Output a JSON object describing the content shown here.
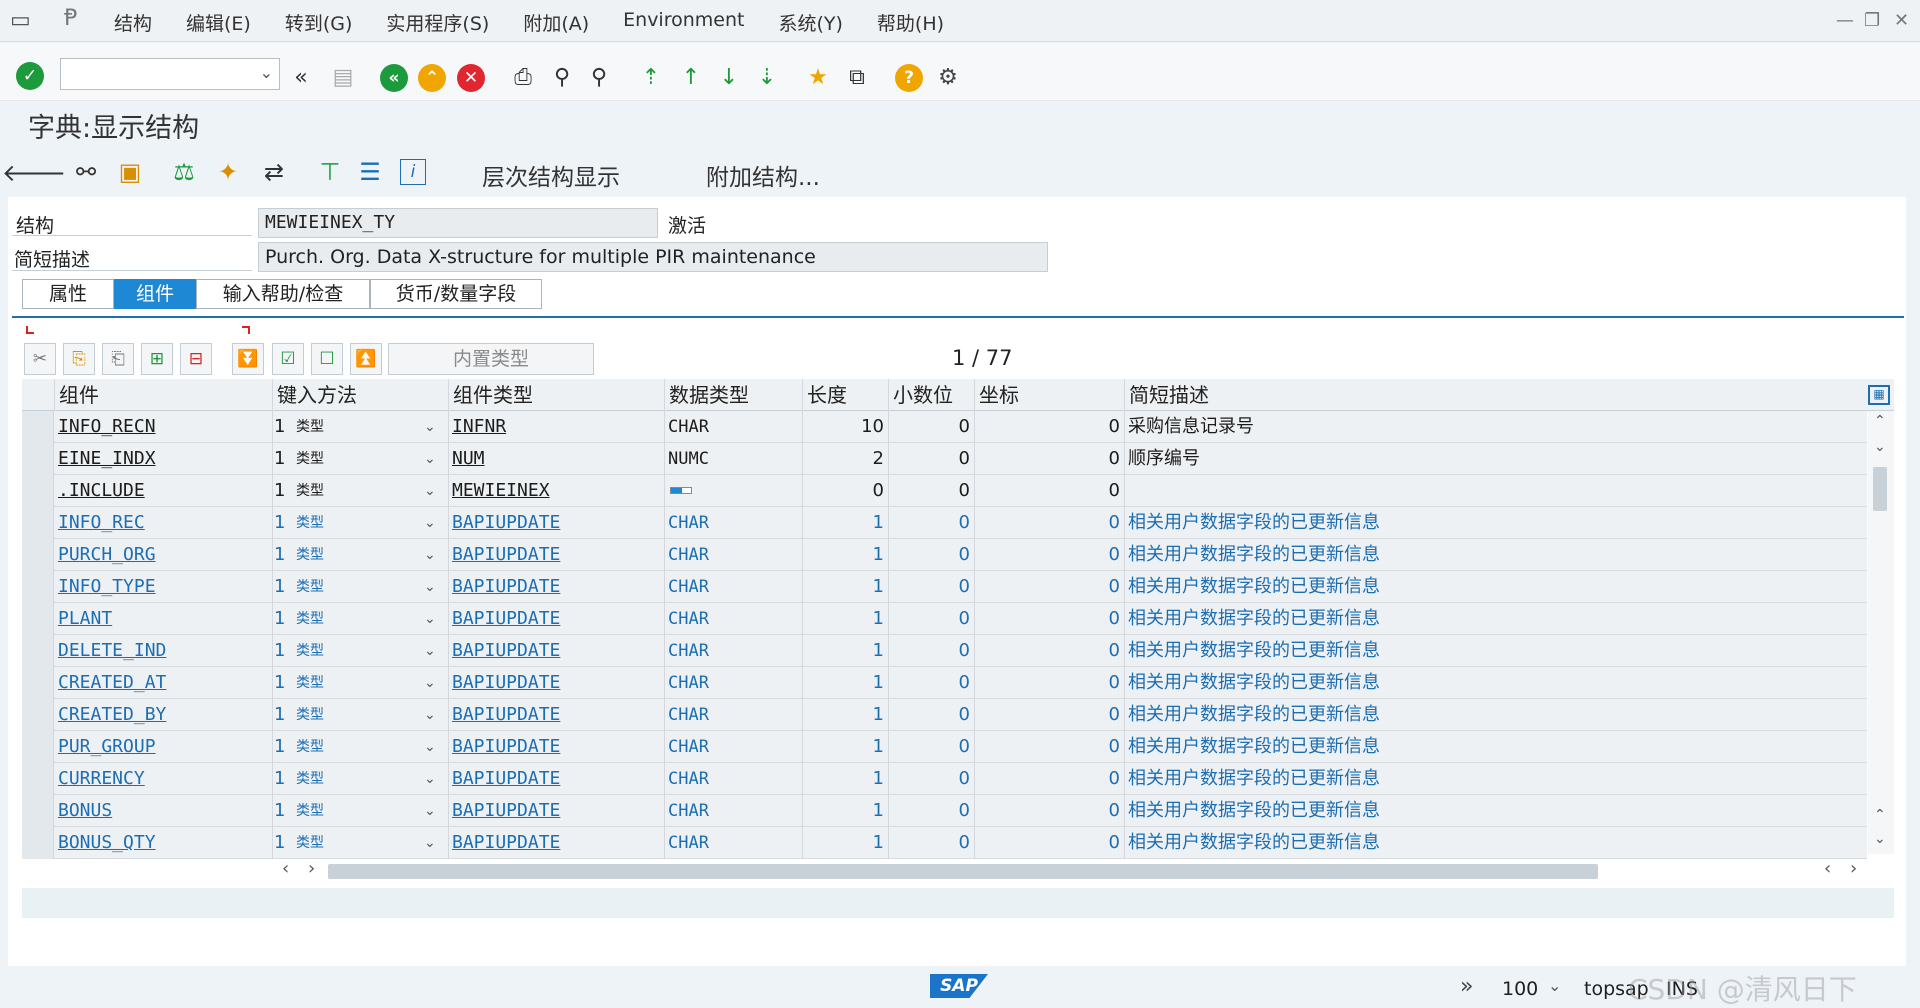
{
  "menu": {
    "items": [
      "结构",
      "编辑(E)",
      "转到(G)",
      "实用程序(S)",
      "附加(A)",
      "Environment",
      "系统(Y)",
      "帮助(H)"
    ]
  },
  "window": {
    "min": "—",
    "restore": "❐",
    "close": "✕"
  },
  "toolbar": {
    "icons": [
      "enter-icon",
      "back-nav-icon",
      "save-icon",
      "back-icon",
      "exit-icon",
      "cancel-icon",
      "print-icon",
      "find-icon",
      "find-next-icon",
      "first-page-icon",
      "prev-page-icon",
      "next-page-icon",
      "last-page-icon",
      "new-session-icon",
      "shortcut-icon",
      "help-icon",
      "settings-icon"
    ]
  },
  "page": {
    "title": "字典:显示结构"
  },
  "app_toolbar": {
    "hierarchy_label": "层次结构显示",
    "append_label": "附加结构..."
  },
  "header": {
    "struct_label": "结构",
    "struct_value": "MEWIEINEX_TY",
    "status": "激活",
    "desc_label": "简短描述",
    "desc_value": "Purch. Org. Data X-structure for multiple PIR maintenance"
  },
  "tabs": [
    {
      "label": "属性"
    },
    {
      "label": "组件"
    },
    {
      "label": "输入帮助/检查"
    },
    {
      "label": "货币/数量字段"
    }
  ],
  "table_toolbar": {
    "builtin_label": "内置类型",
    "pager": "1 / 77"
  },
  "table": {
    "columns": [
      "组件",
      "键入方法",
      "组件类型",
      "数据类型",
      "长度",
      "小数位",
      "坐标",
      "简短描述"
    ],
    "rows": [
      {
        "component": "INFO_RECN",
        "typing": "1",
        "typing_text": "类型",
        "comp_type": "INFNR",
        "data_type": "CHAR",
        "length": "10",
        "decimals": "0",
        "coord": "0",
        "desc": "采购信息记录号",
        "style": "dark"
      },
      {
        "component": "EINE_INDX",
        "typing": "1",
        "typing_text": "类型",
        "comp_type": "NUM",
        "data_type": "NUMC",
        "length": "2",
        "decimals": "0",
        "coord": "0",
        "desc": "顺序编号",
        "style": "dark"
      },
      {
        "component": ".INCLUDE",
        "typing": "1",
        "typing_text": "类型",
        "comp_type": "MEWIEINEX",
        "data_type": "",
        "length": "0",
        "decimals": "0",
        "coord": "0",
        "desc": "",
        "style": "dark"
      },
      {
        "component": "INFO_REC",
        "typing": "1",
        "typing_text": "类型",
        "comp_type": "BAPIUPDATE",
        "data_type": "CHAR",
        "length": "1",
        "decimals": "0",
        "coord": "0",
        "desc": "相关用户数据字段的已更新信息",
        "style": "blue"
      },
      {
        "component": "PURCH_ORG",
        "typing": "1",
        "typing_text": "类型",
        "comp_type": "BAPIUPDATE",
        "data_type": "CHAR",
        "length": "1",
        "decimals": "0",
        "coord": "0",
        "desc": "相关用户数据字段的已更新信息",
        "style": "blue"
      },
      {
        "component": "INFO_TYPE",
        "typing": "1",
        "typing_text": "类型",
        "comp_type": "BAPIUPDATE",
        "data_type": "CHAR",
        "length": "1",
        "decimals": "0",
        "coord": "0",
        "desc": "相关用户数据字段的已更新信息",
        "style": "blue"
      },
      {
        "component": "PLANT",
        "typing": "1",
        "typing_text": "类型",
        "comp_type": "BAPIUPDATE",
        "data_type": "CHAR",
        "length": "1",
        "decimals": "0",
        "coord": "0",
        "desc": "相关用户数据字段的已更新信息",
        "style": "blue"
      },
      {
        "component": "DELETE_IND",
        "typing": "1",
        "typing_text": "类型",
        "comp_type": "BAPIUPDATE",
        "data_type": "CHAR",
        "length": "1",
        "decimals": "0",
        "coord": "0",
        "desc": "相关用户数据字段的已更新信息",
        "style": "blue"
      },
      {
        "component": "CREATED_AT",
        "typing": "1",
        "typing_text": "类型",
        "comp_type": "BAPIUPDATE",
        "data_type": "CHAR",
        "length": "1",
        "decimals": "0",
        "coord": "0",
        "desc": "相关用户数据字段的已更新信息",
        "style": "blue"
      },
      {
        "component": "CREATED_BY",
        "typing": "1",
        "typing_text": "类型",
        "comp_type": "BAPIUPDATE",
        "data_type": "CHAR",
        "length": "1",
        "decimals": "0",
        "coord": "0",
        "desc": "相关用户数据字段的已更新信息",
        "style": "blue"
      },
      {
        "component": "PUR_GROUP",
        "typing": "1",
        "typing_text": "类型",
        "comp_type": "BAPIUPDATE",
        "data_type": "CHAR",
        "length": "1",
        "decimals": "0",
        "coord": "0",
        "desc": "相关用户数据字段的已更新信息",
        "style": "blue"
      },
      {
        "component": "CURRENCY",
        "typing": "1",
        "typing_text": "类型",
        "comp_type": "BAPIUPDATE",
        "data_type": "CHAR",
        "length": "1",
        "decimals": "0",
        "coord": "0",
        "desc": "相关用户数据字段的已更新信息",
        "style": "blue"
      },
      {
        "component": "BONUS",
        "typing": "1",
        "typing_text": "类型",
        "comp_type": "BAPIUPDATE",
        "data_type": "CHAR",
        "length": "1",
        "decimals": "0",
        "coord": "0",
        "desc": "相关用户数据字段的已更新信息",
        "style": "blue"
      },
      {
        "component": "BONUS_QTY",
        "typing": "1",
        "typing_text": "类型",
        "comp_type": "BAPIUPDATE",
        "data_type": "CHAR",
        "length": "1",
        "decimals": "0",
        "coord": "0",
        "desc": "相关用户数据字段的已更新信息",
        "style": "blue"
      }
    ]
  },
  "statusbar": {
    "logo": "SAP",
    "zoom": "100",
    "system": "topsap",
    "mode": "INS",
    "watermark": "CSDN @清风日下"
  },
  "colors": {
    "accent": "#1e88d4",
    "link": "#1c6eb4",
    "green": "#1d9a3c",
    "orange": "#f0a500",
    "red": "#e0262e"
  }
}
